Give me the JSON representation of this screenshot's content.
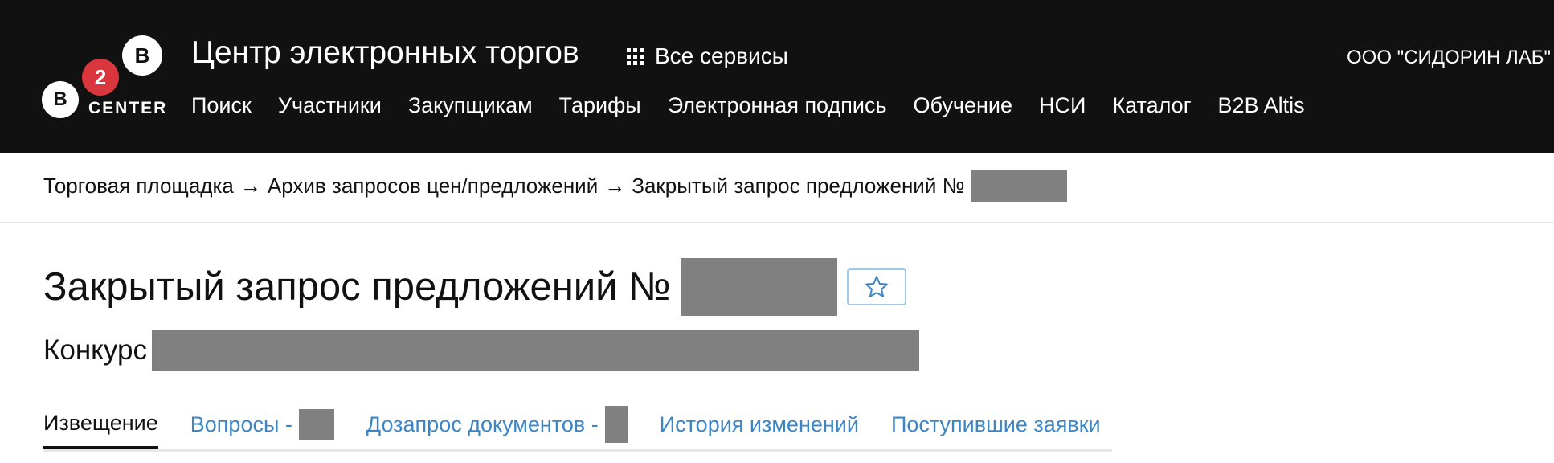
{
  "header": {
    "logo": {
      "letter_top": "B",
      "letter_bottom": "B",
      "number": "2",
      "word": "CENTER"
    },
    "title": "Центр электронных торгов",
    "services_label": "Все сервисы",
    "services_icon": "grid-icon",
    "organization": "ООО \"СИДОРИН ЛАБ\"",
    "nav": [
      "Поиск",
      "Участники",
      "Закупщикам",
      "Тарифы",
      "Электронная подпись",
      "Обучение",
      "НСИ",
      "Каталог",
      "B2B Altis"
    ]
  },
  "breadcrumb": {
    "items": [
      "Торговая площадка",
      "Архив запросов цен/предложений",
      "Закрытый запрос предложений №"
    ],
    "separator": "→"
  },
  "main": {
    "title": "Закрытый запрос предложений №",
    "favorite_icon": "star-icon",
    "subtitle": "Конкурс",
    "tabs": [
      "Извещение",
      "Вопросы -",
      "Дозапрос документов -",
      "История изменений",
      "Поступившие заявки"
    ]
  },
  "colors": {
    "header_bg": "#111111",
    "badge_red": "#d9363e",
    "link_blue": "#3d86c6",
    "redaction": "#808080",
    "favorite_border": "#9cc8ea"
  }
}
